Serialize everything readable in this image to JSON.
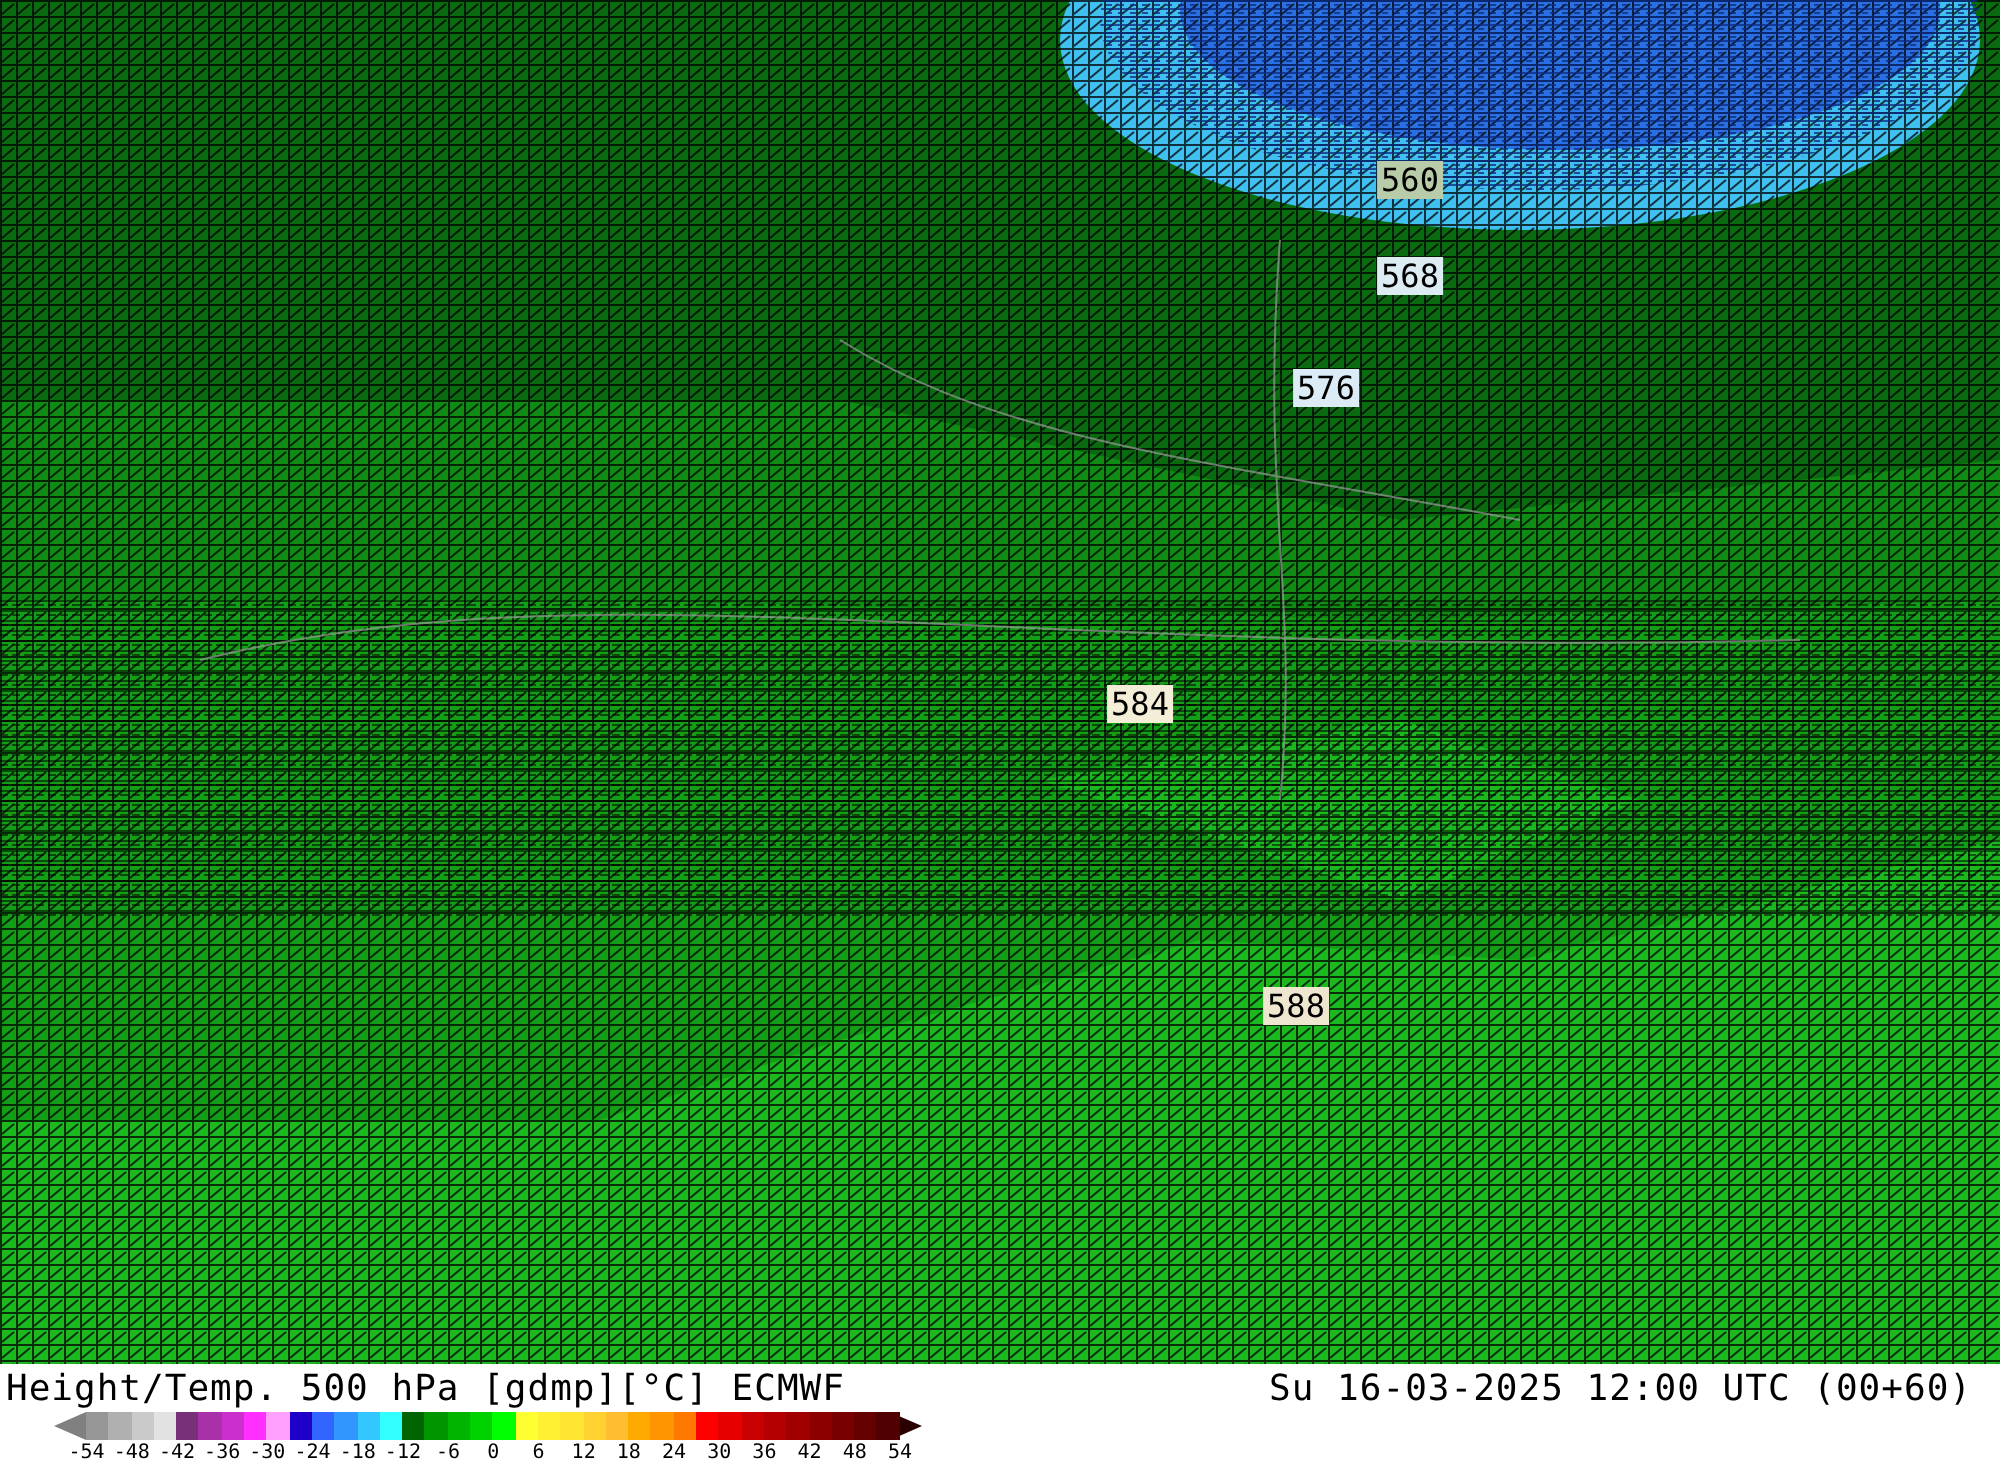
{
  "map": {
    "contour_labels": [
      {
        "text": "560",
        "color": "#b9cca9"
      },
      {
        "text": "568",
        "color": "#dcecf2"
      },
      {
        "text": "576",
        "color": "#dcecf6"
      },
      {
        "text": "584",
        "color": "#f4eed8"
      },
      {
        "text": "588",
        "color": "#efe6cf"
      }
    ]
  },
  "title": "Height/Temp. 500 hPa [gdmp][°C] ECMWF",
  "valid_time": "Su 16-03-2025 12:00 UTC (00+60)",
  "legend": {
    "swatches": [
      {
        "color": "#969696"
      },
      {
        "color": "#b0b0b0"
      },
      {
        "color": "#cacaca"
      },
      {
        "color": "#e2e2e2"
      },
      {
        "color": "#783078"
      },
      {
        "color": "#a830a8"
      },
      {
        "color": "#cc30cc"
      },
      {
        "color": "#ff30ff"
      },
      {
        "color": "#ffa0ff"
      },
      {
        "color": "#1e00c8"
      },
      {
        "color": "#3264ff"
      },
      {
        "color": "#3296ff"
      },
      {
        "color": "#32c8ff"
      },
      {
        "color": "#32ffff"
      },
      {
        "color": "#006400"
      },
      {
        "color": "#009600"
      },
      {
        "color": "#00b400"
      },
      {
        "color": "#00d200"
      },
      {
        "color": "#00ff00"
      },
      {
        "color": "#ffff32"
      },
      {
        "color": "#fff032"
      },
      {
        "color": "#ffe632"
      },
      {
        "color": "#ffd232"
      },
      {
        "color": "#ffbe32"
      },
      {
        "color": "#ffaa00"
      },
      {
        "color": "#ff9600"
      },
      {
        "color": "#ff7800"
      },
      {
        "color": "#ff0000"
      },
      {
        "color": "#e60000"
      },
      {
        "color": "#c80000"
      },
      {
        "color": "#b40000"
      },
      {
        "color": "#a00000"
      },
      {
        "color": "#8c0000"
      },
      {
        "color": "#780000"
      },
      {
        "color": "#640000"
      },
      {
        "color": "#500000"
      }
    ],
    "ticks": [
      "-54",
      "-48",
      "-42",
      "-36",
      "-30",
      "-24",
      "-18",
      "-12",
      "-6",
      "0",
      "6",
      "12",
      "18",
      "24",
      "30",
      "36",
      "42",
      "48",
      "54"
    ]
  }
}
